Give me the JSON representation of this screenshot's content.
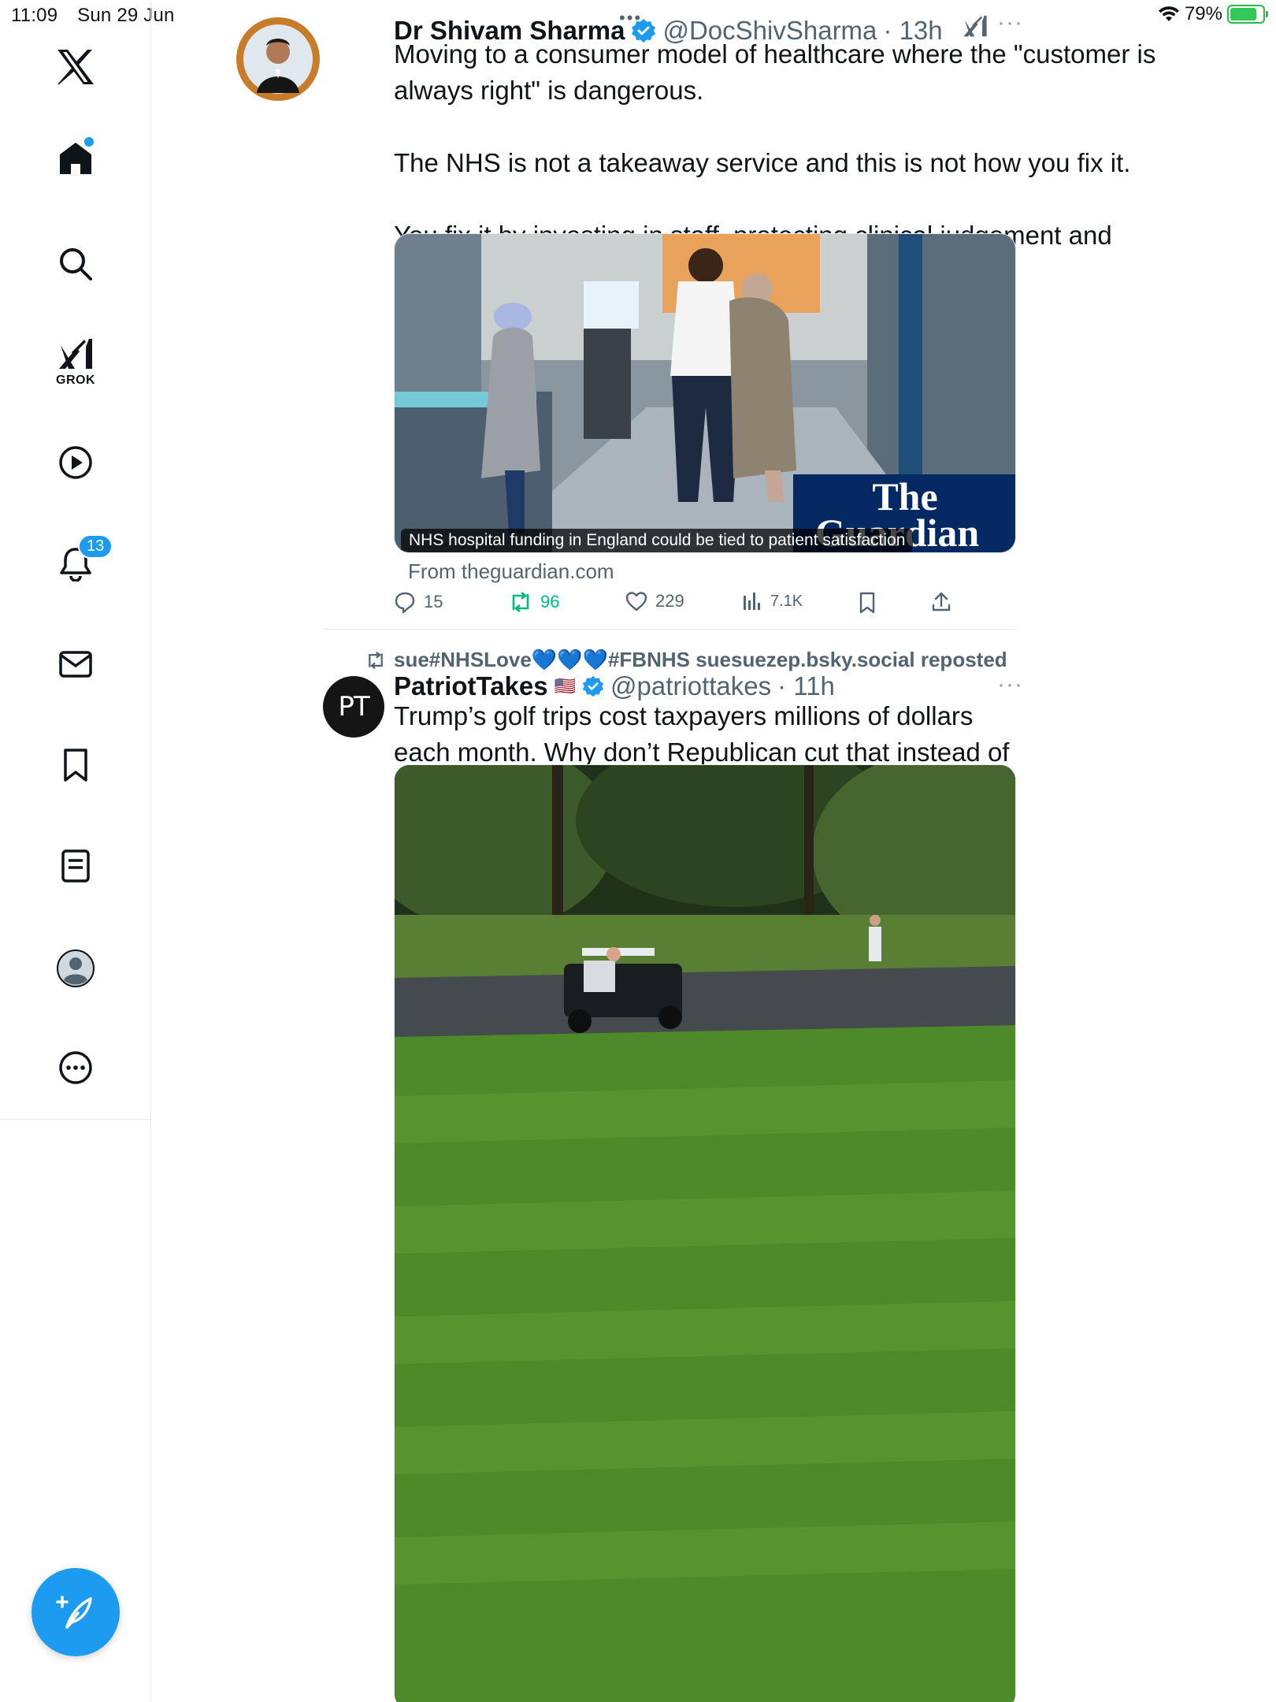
{
  "status_bar": {
    "time": "11:09",
    "date": "Sun 29 Jun",
    "battery": "79%"
  },
  "sidebar": {
    "items": [
      {
        "name": "home",
        "label": ""
      },
      {
        "name": "explore",
        "label": ""
      },
      {
        "name": "grok",
        "label": "GROK"
      },
      {
        "name": "videos",
        "label": ""
      },
      {
        "name": "notifications",
        "label": "",
        "badge": "13"
      },
      {
        "name": "messages",
        "label": ""
      },
      {
        "name": "bookmarks",
        "label": ""
      },
      {
        "name": "lists",
        "label": ""
      },
      {
        "name": "profile",
        "label": ""
      },
      {
        "name": "more",
        "label": ""
      }
    ]
  },
  "posts": [
    {
      "name": "Dr Shivam Sharma",
      "handle": "@DocShivSharma",
      "time": "· 13h",
      "text": "Moving to a consumer model of healthcare where the \"customer is always right\" is dangerous.\n\nThe NHS is not a takeaway service and this is not how you fix it.\n\nYou fix it by investing in staff, protecting clinical judgement and putting care before ratings.",
      "card_caption": "NHS hospital funding in England could be tied to patient satisfaction",
      "card_logo_line1": "The",
      "card_logo_line2": "Guardian",
      "card_source": "From theguardian.com",
      "stats": {
        "replies": "15",
        "reposts": "96",
        "likes": "229",
        "views": "7.1K"
      }
    },
    {
      "repost_by": "sue#NHSLove💙💙💙#FBNHS suesuezep.bsky.social reposted",
      "name": "PatriotTakes",
      "flag": "🇺🇸",
      "avatar_text": "PT",
      "handle": "@patriottakes",
      "time": "· 11h",
      "text": "Trump’s golf trips cost taxpayers millions of dollars each month. Why don’t Republican cut that instead of Medicaid?"
    }
  ],
  "colors": {
    "accent": "#1d9bf0",
    "repost_green": "#00ba7c",
    "text": "#0f1419",
    "muted": "#536471",
    "guardian": "#052962"
  }
}
